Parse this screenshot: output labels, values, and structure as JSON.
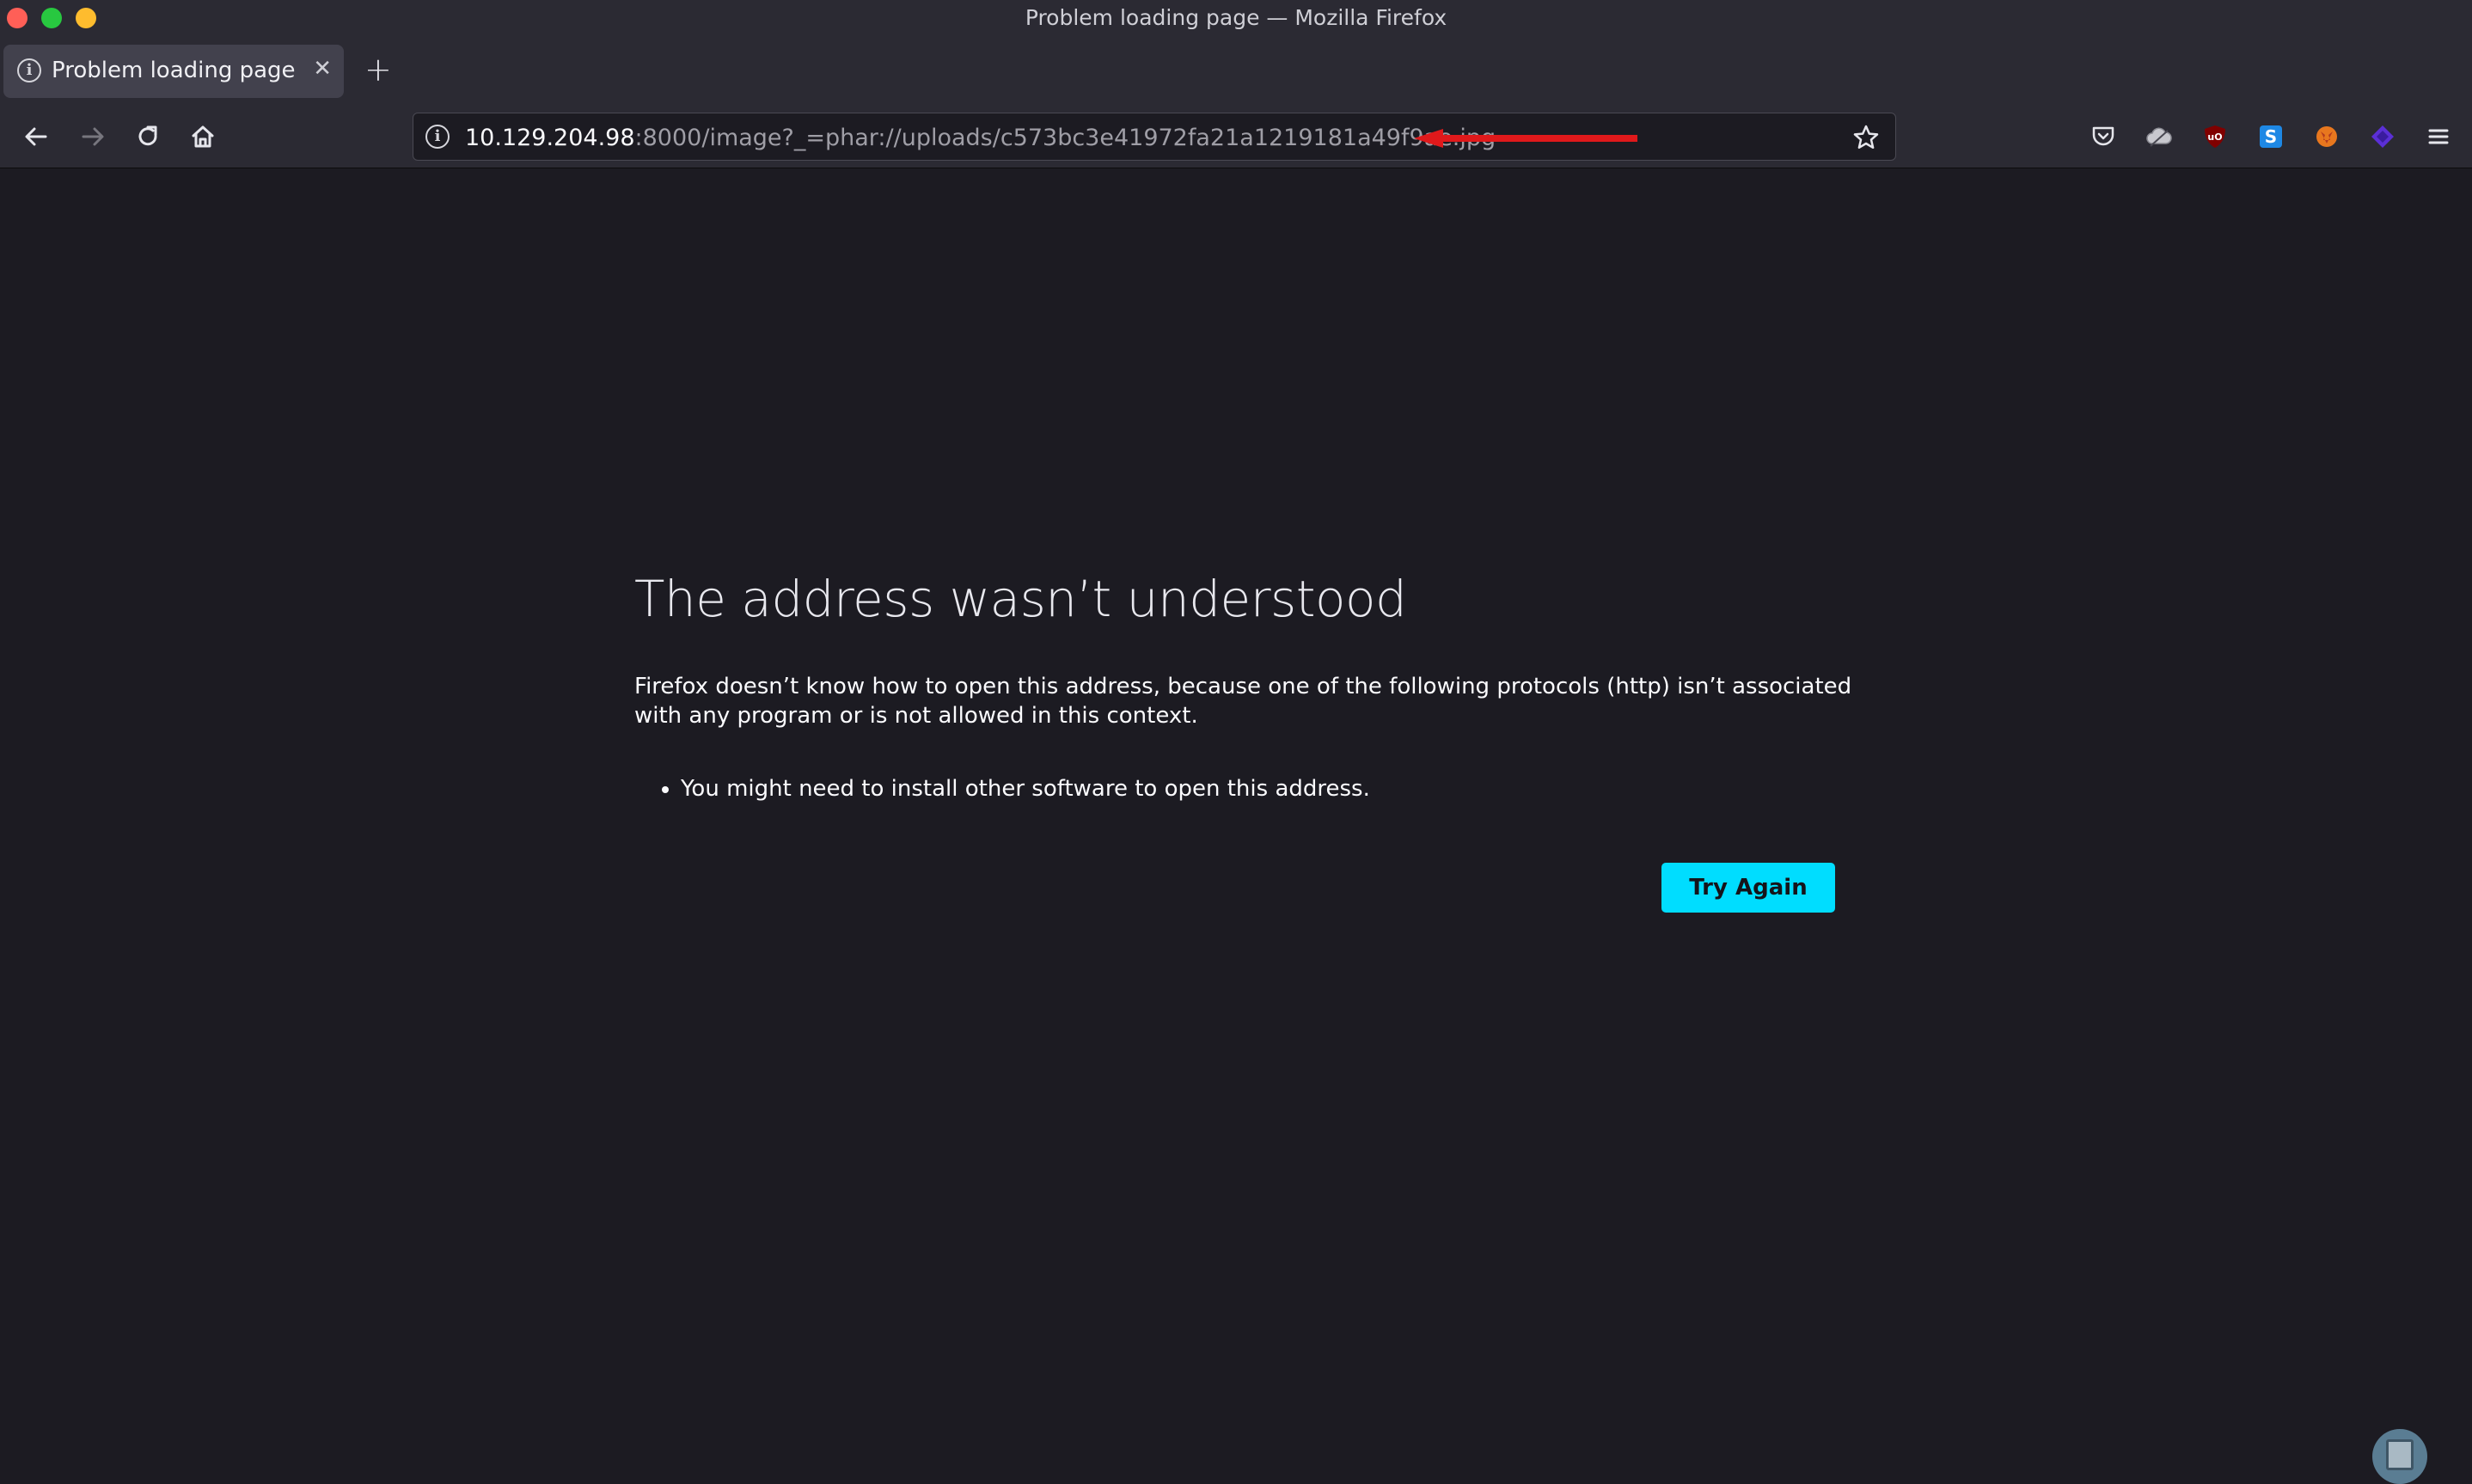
{
  "window": {
    "title": "Problem loading page — Mozilla Firefox"
  },
  "tabs": [
    {
      "label": "Problem loading page",
      "icon": "info-icon",
      "close_label": "✕"
    }
  ],
  "new_tab_label": "+",
  "urlbar": {
    "host": "10.129.204.98",
    "rest": ":8000/image?_=phar://uploads/c573bc3e41972fa21a1219181a49f9ae.jpg",
    "annotation": "red-arrow-pointing-at-url"
  },
  "toolbar_extensions": [
    "pocket-icon",
    "cloud-icon",
    "ublock-origin-icon",
    "s-extension-icon",
    "foxyproxy-icon",
    "wappalyzer-icon",
    "menu-icon"
  ],
  "error_page": {
    "title": "The address wasn’t understood",
    "description": "Firefox doesn’t know how to open this address, because one of the following protocols (http) isn’t associated with any program or is not allowed in this context.",
    "bullets": [
      "You might need to install other software to open this address."
    ],
    "try_again_label": "Try Again"
  },
  "colors": {
    "accent_button": "#00ddff",
    "arrow": "#e0191b",
    "background": "#1c1b22",
    "chrome": "#2b2a33"
  }
}
